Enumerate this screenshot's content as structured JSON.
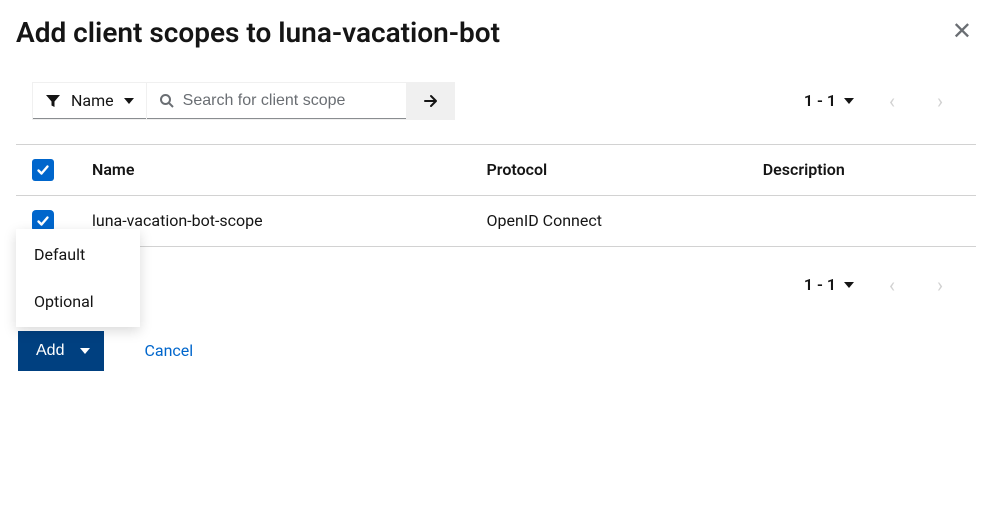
{
  "modal": {
    "title": "Add client scopes to luna-vacation-bot"
  },
  "toolbar": {
    "filter_label": "Name",
    "search_placeholder": "Search for client scope"
  },
  "pager": {
    "range": "1 - 1"
  },
  "table": {
    "headers": {
      "name": "Name",
      "protocol": "Protocol",
      "description": "Description"
    },
    "rows": [
      {
        "name": "luna-vacation-bot-scope",
        "protocol": "OpenID Connect",
        "description": ""
      }
    ]
  },
  "footer": {
    "add_label": "Add",
    "cancel_label": "Cancel",
    "menu": {
      "default": "Default",
      "optional": "Optional"
    }
  }
}
